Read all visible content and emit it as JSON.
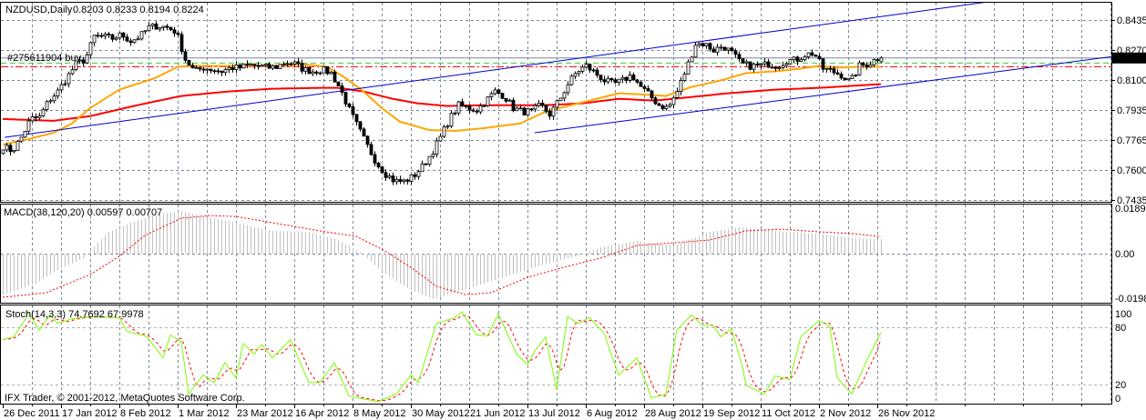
{
  "header": {
    "symbol_label": "NZDUSD,Daily",
    "ohlc_label": "0.8203 0.8233 0.8194 0.8224",
    "order_label": "#275611904 buy",
    "macd_label": "MACD(38,120,20) 0.00597 0.00707",
    "stoch_label": "Stoch(14,3,3) 74.7692 67.9978",
    "copyright": "IFX Trader, © 2001-2012, MetaQuotes Software Corp."
  },
  "colors": {
    "grid": "#778899",
    "ma_fast": "#FFA500",
    "ma_slow": "#FF0000",
    "trendline": "#0000CD",
    "stoch_k": "#7CFC00",
    "stoch_d": "#FF0000",
    "macd_hist": "#C0C0C0",
    "macd_signal": "#FF0000",
    "order_line": "#32CD32",
    "sl_line": "#FF0000",
    "bid_line": "#778899"
  },
  "chart_data": [
    {
      "type": "candlestick",
      "title": "NZDUSD,Daily",
      "bar_count": 242,
      "ylim": [
        0.7435,
        0.8435
      ],
      "y_ticks": [
        "0.8435",
        "0.8270",
        "0.8100",
        "0.7935",
        "0.7765",
        "0.7600",
        "0.7435"
      ],
      "current_price": "0.8224",
      "x_ticks": [
        "26 Dec 2011",
        "17 Jan 2012",
        "8 Feb 2012",
        "1 Mar 2012",
        "23 Mar 2012",
        "16 Apr 2012",
        "8 May 2012",
        "30 May 2012",
        "21 Jun 2012",
        "13 Jul 2012",
        "6 Aug 2012",
        "28 Aug 2012",
        "19 Sep 2012",
        "11 Oct 2012",
        "2 Nov 2012",
        "26 Nov 2012"
      ],
      "x_tick_every_bars": 16,
      "close_keypoints_step_bars": 2.5,
      "close_keypoints": [
        0.7733,
        0.7707,
        0.7783,
        0.7885,
        0.7895,
        0.7987,
        0.8038,
        0.8114,
        0.8191,
        0.8216,
        0.8343,
        0.8343,
        0.8333,
        0.8354,
        0.8318,
        0.8343,
        0.8394,
        0.8404,
        0.8394,
        0.8369,
        0.8216,
        0.815,
        0.817,
        0.816,
        0.815,
        0.817,
        0.817,
        0.8185,
        0.818,
        0.817,
        0.8175,
        0.8201,
        0.8191,
        0.816,
        0.815,
        0.816,
        0.814,
        0.8053,
        0.7936,
        0.7834,
        0.7733,
        0.7641,
        0.758,
        0.7539,
        0.7539,
        0.7565,
        0.762,
        0.7692,
        0.7783,
        0.7885,
        0.7962,
        0.7946,
        0.7936,
        0.7987,
        0.8038,
        0.8013,
        0.7946,
        0.7926,
        0.7926,
        0.7962,
        0.7911,
        0.7987,
        0.8079,
        0.815,
        0.818,
        0.814,
        0.8099,
        0.8079,
        0.8099,
        0.813,
        0.8063,
        0.8013,
        0.7962,
        0.7946,
        0.8038,
        0.8165,
        0.8303,
        0.8303,
        0.8267,
        0.8292,
        0.8252,
        0.8191,
        0.818,
        0.818,
        0.8191,
        0.818,
        0.8211,
        0.8211,
        0.8242,
        0.8252,
        0.8165,
        0.815,
        0.813,
        0.8089,
        0.818,
        0.8191,
        0.8224
      ],
      "ma_fast": {
        "bars": [
          0,
          7,
          14,
          19,
          24,
          32,
          42,
          48,
          52,
          64,
          77,
          82,
          89,
          94,
          99,
          104,
          109,
          117,
          124,
          132,
          142,
          149,
          159,
          169,
          174,
          182,
          189,
          197,
          204,
          212,
          219,
          224,
          229,
          234,
          241
        ],
        "values": [
          0.7743,
          0.7773,
          0.7809,
          0.786,
          0.7946,
          0.8048,
          0.8114,
          0.8175,
          0.818,
          0.818,
          0.818,
          0.8191,
          0.8175,
          0.8114,
          0.8038,
          0.7946,
          0.787,
          0.7824,
          0.7819,
          0.7834,
          0.786,
          0.7926,
          0.7977,
          0.8028,
          0.8023,
          0.8013,
          0.8063,
          0.8099,
          0.814,
          0.815,
          0.8165,
          0.818,
          0.817,
          0.8175,
          0.8175
        ]
      },
      "ma_slow": {
        "bars": [
          0,
          14,
          24,
          37,
          49,
          62,
          74,
          87,
          92,
          99,
          107,
          114,
          122,
          132,
          149,
          159,
          169,
          179,
          189,
          199,
          212,
          224,
          241
        ],
        "values": [
          0.7885,
          0.7875,
          0.7901,
          0.7962,
          0.8013,
          0.8038,
          0.8053,
          0.8058,
          0.8058,
          0.8038,
          0.7997,
          0.7972,
          0.7957,
          0.7962,
          0.7962,
          0.7972,
          0.7997,
          0.7987,
          0.8007,
          0.8028,
          0.8048,
          0.8058,
          0.8079
        ]
      },
      "trendlines": [
        {
          "from_bar": 0.5,
          "from_price": 0.7783,
          "to_bar": 269,
          "to_price": 0.8532
        },
        {
          "from_bar": 146,
          "from_price": 0.7809,
          "to_bar": 314,
          "to_price": 0.8257
        }
      ],
      "horizontal_lines": {
        "order_price": 0.8196,
        "stop_price": 0.8175
      }
    },
    {
      "type": "bar",
      "title": "MACD(38,120,20)",
      "ylim": [
        -0.01987,
        0.01896
      ],
      "y_ticks": [
        "0.01896",
        "0.00",
        "-0.01987"
      ],
      "histogram": {
        "bars": [
          0,
          4,
          9,
          14,
          22,
          24,
          29,
          37,
          44,
          49,
          54,
          64,
          74,
          84,
          92,
          97,
          99,
          104,
          112,
          118,
          124,
          132,
          142,
          152,
          159,
          164,
          174,
          184,
          194,
          202,
          212,
          224,
          234,
          241
        ],
        "values": [
          -0.0171,
          -0.0152,
          -0.0125,
          -0.0076,
          -0.0019,
          0.0015,
          0.0091,
          0.014,
          0.0167,
          0.0178,
          0.0159,
          0.0129,
          0.0095,
          0.0091,
          0.0057,
          0.0015,
          -0.0004,
          -0.0076,
          -0.0152,
          -0.019,
          -0.0163,
          -0.0125,
          -0.0076,
          -0.003,
          -0.0004,
          0.0027,
          0.0053,
          0.0034,
          0.0091,
          0.011,
          0.0095,
          0.0083,
          0.0064,
          0.00597
        ]
      },
      "signal": {
        "bars": [
          0,
          12,
          24,
          32,
          39,
          49,
          57,
          64,
          74,
          87,
          97,
          104,
          112,
          119,
          127,
          134,
          144,
          154,
          164,
          174,
          184,
          194,
          204,
          214,
          224,
          234,
          241
        ],
        "values": [
          -0.0182,
          -0.0163,
          -0.0087,
          -0.0011,
          0.0076,
          0.0148,
          0.0159,
          0.0155,
          0.0129,
          0.0095,
          0.0072,
          0.0019,
          -0.0057,
          -0.0136,
          -0.0171,
          -0.0163,
          -0.0099,
          -0.0057,
          -0.0019,
          0.0034,
          0.0045,
          0.0057,
          0.0095,
          0.0102,
          0.0091,
          0.0083,
          0.00707
        ]
      }
    },
    {
      "type": "line",
      "title": "Stoch(14,3,3)",
      "ylim": [
        0,
        100
      ],
      "y_ticks": [
        "100",
        "80",
        "20",
        "0"
      ],
      "k": {
        "bars": [
          0,
          3,
          6,
          7,
          10,
          13,
          15,
          19,
          24,
          32,
          34,
          39,
          40,
          44,
          46,
          49,
          51,
          55,
          58,
          61,
          64,
          66,
          69,
          71,
          74,
          79,
          84,
          87,
          91,
          95,
          103,
          108,
          112,
          114,
          119,
          124,
          126,
          130,
          133,
          136,
          141,
          144,
          146,
          149,
          152,
          155,
          158,
          161,
          165,
          169,
          174,
          178,
          182,
          185,
          189,
          192,
          195,
          197,
          200,
          203,
          204,
          209,
          212,
          216,
          219,
          224,
          227,
          229,
          233,
          237,
          241
        ],
        "values": [
          67,
          70,
          87,
          96,
          77,
          93,
          84,
          89,
          91,
          90,
          76,
          71,
          68,
          48,
          72,
          65,
          10,
          30,
          22,
          43,
          27,
          63,
          52,
          62,
          48,
          67,
          22,
          22,
          43,
          8,
          2,
          10,
          30,
          22,
          84,
          90,
          96,
          72,
          71,
          94,
          52,
          41,
          55,
          70,
          15,
          91,
          84,
          90,
          74,
          30,
          48,
          6,
          10,
          77,
          93,
          82,
          82,
          70,
          78,
          39,
          19,
          10,
          29,
          25,
          70,
          87,
          81,
          27,
          10,
          44,
          74.77
        ]
      },
      "d_last": 68.0
    }
  ]
}
